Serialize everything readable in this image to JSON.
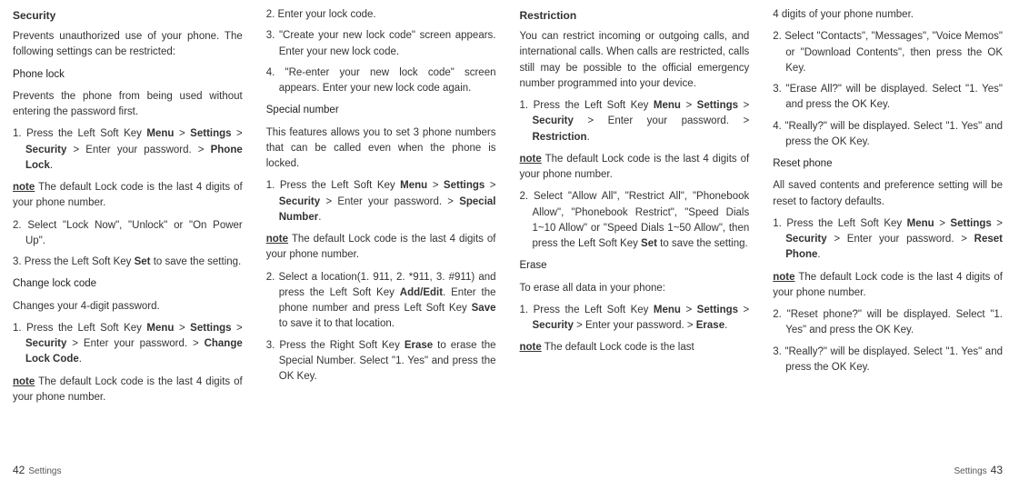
{
  "col1": {
    "security_heading": "Security",
    "security_intro": "Prevents unauthorized use of your phone. The following settings can be restricted:",
    "phone_lock_heading": "Phone lock",
    "phone_lock_intro": "Prevents the phone from being used without entering the password first.",
    "phone_lock_steps": [
      {
        "num": "1.",
        "pre": "Press the Left Soft Key ",
        "b1": "Menu",
        "mid1": " > ",
        "b2": "Settings",
        "mid2": " > ",
        "b3": "Security",
        "mid3": " > Enter your password. > ",
        "b4": "Phone Lock",
        "tail": "."
      },
      {
        "num": "2.",
        "text": "Select \"Lock Now\", \"Unlock\" or \"On Power Up\"."
      },
      {
        "num": "3.",
        "pre": "Press the Left Soft Key ",
        "b1": "Set",
        "tail": " to save the setting."
      }
    ],
    "note_label": "note",
    "note_text": " The default Lock code is the last 4 digits of your phone number.",
    "change_lock_heading": "Change lock code",
    "change_lock_intro": "Changes your 4-digit password.",
    "change_lock_steps": [
      {
        "num": "1.",
        "pre": "Press the Left Soft Key ",
        "b1": "Menu",
        "mid1": " > ",
        "b2": "Settings",
        "mid2": " > ",
        "b3": "Security",
        "mid3": " > Enter your password. > ",
        "b4": "Change Lock Code",
        "tail": "."
      }
    ]
  },
  "col2": {
    "steps": [
      {
        "num": "2.",
        "text": "Enter your lock code."
      },
      {
        "num": "3.",
        "text": "\"Create your new lock code\" screen appears. Enter your new lock code."
      },
      {
        "num": "4.",
        "text": "\"Re-enter your new lock code\" screen appears. Enter your new lock code again."
      }
    ],
    "special_heading": "Special number",
    "special_intro": "This features allows you to set 3 phone numbers that can be called even when the phone is locked.",
    "special_steps": [
      {
        "num": "1.",
        "pre": "Press the Left Soft Key ",
        "b1": "Menu",
        "mid1": " > ",
        "b2": "Settings",
        "mid2": " > ",
        "b3": "Security",
        "mid3": " > Enter your password. > ",
        "b4": "Special Number",
        "tail": "."
      },
      {
        "num": "2.",
        "pre": "Select a location(1. 911, 2. *911, 3. #911) and press the Left Soft Key ",
        "b1": "Add/Edit",
        "mid1": ". Enter the phone number and press Left Soft Key ",
        "b2": "Save",
        "tail": " to save it to that location."
      },
      {
        "num": "3.",
        "pre": "Press the Right Soft Key ",
        "b1": "Erase",
        "tail": " to erase the Special Number. Select \"1. Yes\" and press the OK Key."
      }
    ],
    "note_label": "note",
    "note_text": " The default Lock code is the last 4 digits of your phone number."
  },
  "col3": {
    "restriction_heading": "Restriction",
    "restriction_intro": "You can restrict incoming or outgoing calls, and international calls. When calls are restricted, calls still may be possible to the official emergency number programmed into your device.",
    "restriction_steps": [
      {
        "num": "1.",
        "pre": "Press the Left Soft Key ",
        "b1": "Menu",
        "mid1": " > ",
        "b2": "Settings",
        "mid2": " > ",
        "b3": "Security",
        "mid3": " > Enter your password. > ",
        "b4": "Restriction",
        "tail": "."
      },
      {
        "num": "2.",
        "pre": "Select \"Allow All\", \"Restrict All\", \"Phonebook Allow\", \"Phonebook Restrict\", \"Speed Dials 1~10 Allow\" or \"Speed Dials 1~50 Allow\", then press the Left Soft Key ",
        "b1": "Set",
        "tail": " to save the setting."
      }
    ],
    "note_label": "note",
    "note_text": " The default Lock code is the last 4 digits of your phone number.",
    "erase_heading": "Erase",
    "erase_intro": "To erase all data in your phone:",
    "erase_steps": [
      {
        "num": "1.",
        "pre": "Press the Left Soft Key ",
        "b1": "Menu",
        "mid1": " > ",
        "b2": "Settings",
        "mid2": " > ",
        "b3": "Security",
        "mid3": " > Enter your password. > ",
        "b4": "Erase",
        "tail": "."
      }
    ],
    "note2_text": " The default Lock code is the last"
  },
  "col4": {
    "cont": "4 digits of your phone number.",
    "steps": [
      {
        "num": "2.",
        "text": "Select \"Contacts\", \"Messages\", \"Voice Memos\" or \"Download Contents\", then press the OK Key."
      },
      {
        "num": "3.",
        "text": "\"Erase All?\" will be displayed. Select \"1. Yes\" and press the OK Key."
      },
      {
        "num": "4.",
        "text": "\"Really?\" will be displayed. Select \"1. Yes\" and press the OK Key."
      }
    ],
    "reset_heading": "Reset phone",
    "reset_intro": "All saved contents and preference setting will be reset to factory defaults.",
    "reset_steps": [
      {
        "num": "1.",
        "pre": "Press the Left Soft Key ",
        "b1": "Menu",
        "mid1": " > ",
        "b2": "Settings",
        "mid2": " > ",
        "b3": "Security",
        "mid3": " > Enter your password. > ",
        "b4": "Reset Phone",
        "tail": "."
      },
      {
        "num": "2.",
        "text": "\"Reset phone?\" will be displayed. Select \"1. Yes\" and press the OK Key."
      },
      {
        "num": "3.",
        "text": "\"Really?\" will be displayed. Select \"1. Yes\" and press the OK Key."
      }
    ],
    "note_label": "note",
    "note_text": " The default Lock code is the last 4 digits of your phone number."
  },
  "footer": {
    "left_page": "42",
    "left_label": "Settings",
    "right_label": "Settings",
    "right_page": "43"
  }
}
